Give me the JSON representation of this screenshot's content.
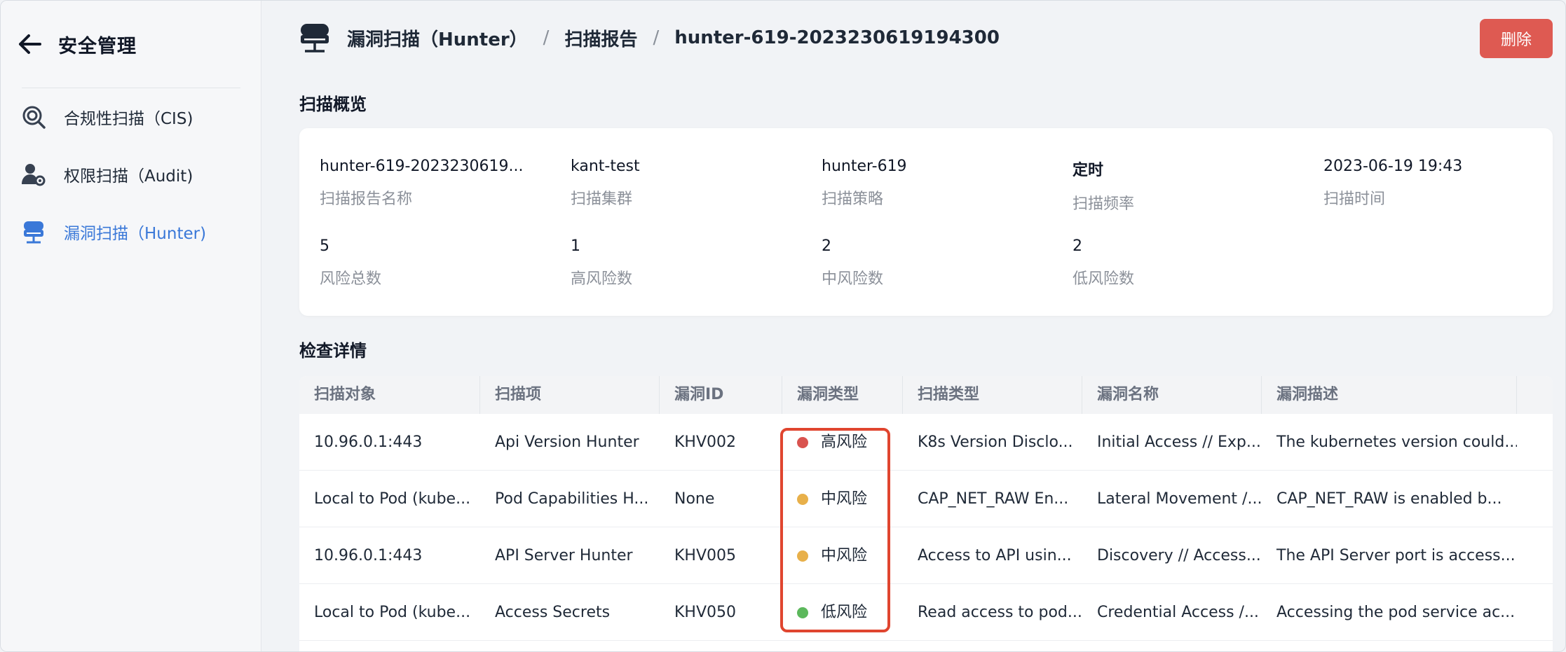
{
  "sidebar": {
    "title": "安全管理",
    "items": [
      {
        "label": "合规性扫描（CIS)",
        "icon": "cis-scan-icon"
      },
      {
        "label": "权限扫描（Audit)",
        "icon": "audit-scan-icon"
      },
      {
        "label": "漏洞扫描（Hunter)",
        "icon": "hunter-scan-icon",
        "active": true
      }
    ]
  },
  "breadcrumb": {
    "items": [
      "漏洞扫描（Hunter）",
      "扫描报告",
      "hunter-619-2023230619194300"
    ],
    "separator": "/"
  },
  "actions": {
    "delete_label": "删除"
  },
  "overview": {
    "title": "扫描概览",
    "row1": [
      {
        "value": "hunter-619-2023230619...",
        "label": "扫描报告名称"
      },
      {
        "value": "kant-test",
        "label": "扫描集群"
      },
      {
        "value": "hunter-619",
        "label": "扫描策略"
      },
      {
        "value": "定时",
        "label": "扫描频率"
      },
      {
        "value": "2023-06-19 19:43",
        "label": "扫描时间"
      }
    ],
    "row2": [
      {
        "value": "5",
        "label": "风险总数"
      },
      {
        "value": "1",
        "label": "高风险数"
      },
      {
        "value": "2",
        "label": "中风险数"
      },
      {
        "value": "2",
        "label": "低风险数"
      }
    ]
  },
  "details": {
    "title": "检查详情",
    "columns": [
      "扫描对象",
      "扫描项",
      "漏洞ID",
      "漏洞类型",
      "扫描类型",
      "漏洞名称",
      "漏洞描述"
    ],
    "rows": [
      [
        "10.96.0.1:443",
        "Api Version Hunter",
        "KHV002",
        "高风险",
        "K8s Version Disclo...",
        "Initial Access // Exp...",
        "The kubernetes version could..."
      ],
      [
        "Local to Pod (kube...",
        "Pod Capabilities H...",
        "None",
        "中风险",
        "CAP_NET_RAW En...",
        "Lateral Movement /...",
        "CAP_NET_RAW is enabled b..."
      ],
      [
        "10.96.0.1:443",
        "API Server Hunter",
        "KHV005",
        "中风险",
        "Access to API usin...",
        "Discovery // Access...",
        "The API Server port is access..."
      ],
      [
        "Local to Pod (kube...",
        "Access Secrets",
        "KHV050",
        "低风险",
        "Read access to pod...",
        "Credential Access /...",
        "Accessing the pod service ac..."
      ]
    ],
    "risk_colors": [
      "#d9534f",
      "#e8b04a",
      "#e8b04a",
      "#5cb85c"
    ]
  },
  "colors": {
    "accent": "#3a78d8",
    "danger": "#de5a52",
    "highlight": "#e0452f"
  }
}
